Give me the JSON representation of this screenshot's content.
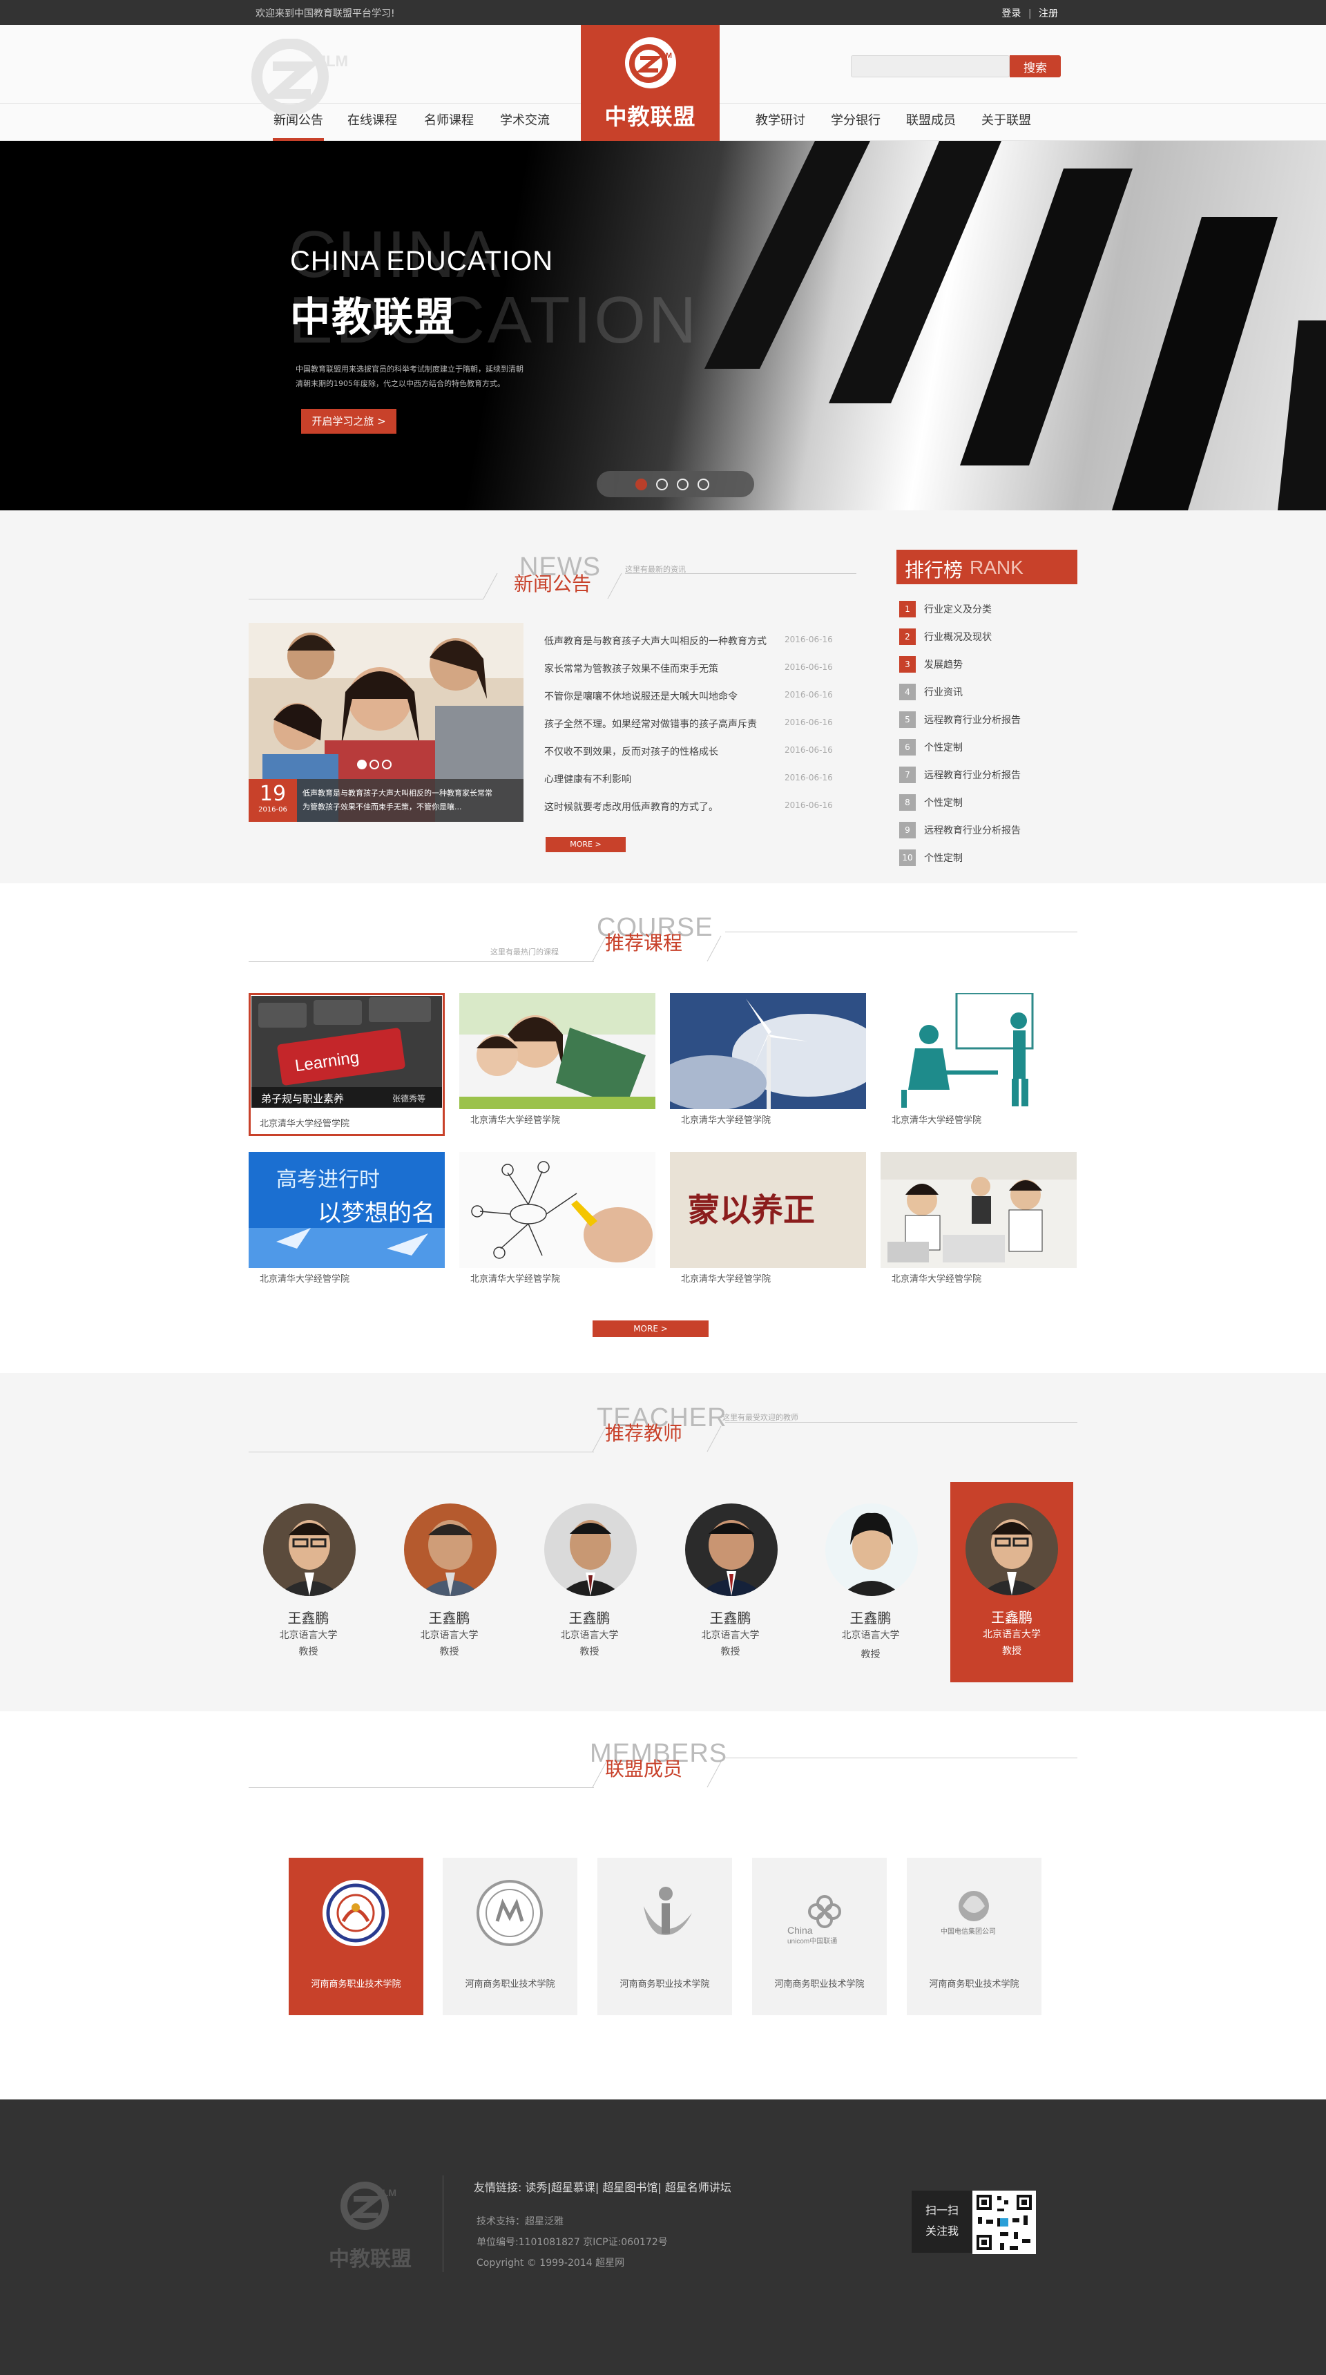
{
  "topbar": {
    "welcome": "欢迎来到中国教育联盟平台学习!",
    "login": "登录",
    "separator": "|",
    "register": "注册"
  },
  "header": {
    "brand_name": "中教联盟",
    "logo_letters": "JLM",
    "search_placeholder": "",
    "search_button": "搜索",
    "nav_left": [
      "新闻公告",
      "在线课程",
      "名师课程",
      "学术交流"
    ],
    "nav_right": [
      "教学研讨",
      "学分银行",
      "联盟成员",
      "关于联盟"
    ],
    "active_nav": "新闻公告"
  },
  "hero": {
    "ghost_line1": "CHINA",
    "ghost_line2": "EDUCATION",
    "title_en": "CHINA EDUCATION",
    "title_cn": "中教联盟",
    "desc_line1": "中国教育联盟用来选拔官员的科举考试制度建立于隋朝，延续到清朝",
    "desc_line2": "清朝末期的1905年废除，代之以中西方结合的特色教育方式。",
    "button": "开启学习之旅 >",
    "slides": 4,
    "active_slide": 1
  },
  "news": {
    "title_en": "NEWS",
    "title_cn": "新闻公告",
    "subtitle": "这里有最新的资讯",
    "feature_day": "19",
    "feature_month": "2016-06",
    "feature_caption1": "低声教育是与教育孩子大声大叫相反的一种教育家长常常",
    "feature_caption2": "为管教孩子效果不佳而束手无策，不管你是嚷...",
    "items": [
      {
        "title": "低声教育是与教育孩子大声大叫相反的一种教育方式",
        "date": "2016-06-16"
      },
      {
        "title": "家长常常为管教孩子效果不佳而束手无策",
        "date": "2016-06-16"
      },
      {
        "title": "不管你是嚷嚷不休地说服还是大喊大叫地命令",
        "date": "2016-06-16"
      },
      {
        "title": "孩子全然不理。如果经常对做错事的孩子高声斥责",
        "date": "2016-06-16"
      },
      {
        "title": "不仅收不到效果，反而对孩子的性格成长",
        "date": "2016-06-16"
      },
      {
        "title": "心理健康有不利影响",
        "date": "2016-06-16"
      },
      {
        "title": "这时候就要考虑改用低声教育的方式了。",
        "date": "2016-06-16"
      }
    ],
    "more": "MORE >"
  },
  "rank": {
    "title_cn": "排行榜",
    "title_en": "RANK",
    "items": [
      {
        "n": "1",
        "label": "行业定义及分类"
      },
      {
        "n": "2",
        "label": "行业概况及现状"
      },
      {
        "n": "3",
        "label": "发展趋势"
      },
      {
        "n": "4",
        "label": "行业资讯"
      },
      {
        "n": "5",
        "label": "远程教育行业分析报告"
      },
      {
        "n": "6",
        "label": "个性定制"
      },
      {
        "n": "7",
        "label": "远程教育行业分析报告"
      },
      {
        "n": "8",
        "label": "个性定制"
      },
      {
        "n": "9",
        "label": "远程教育行业分析报告"
      },
      {
        "n": "10",
        "label": "个性定制"
      }
    ],
    "colors": {
      "top": "#c8412a",
      "rest": "#a9a9a9"
    }
  },
  "course": {
    "title_en": "COURSE",
    "title_cn": "推荐课程",
    "subtitle": "这里有最热门的课程",
    "featured_overlay": "弟子规与职业素养",
    "featured_teacher": "张德秀等",
    "featured_img_word": "Learning",
    "gaokao_line1": "高考进行时",
    "gaokao_line2": "以梦想的名",
    "calligraphy": "蒙以养正",
    "items": [
      "北京清华大学经管学院",
      "北京清华大学经管学院",
      "北京清华大学经管学院",
      "北京清华大学经管学院",
      "北京清华大学经管学院",
      "北京清华大学经管学院",
      "北京清华大学经管学院",
      "北京清华大学经管学院"
    ],
    "more": "MORE >"
  },
  "teacher": {
    "title_en": "TEACHER",
    "title_cn": "推荐教师",
    "subtitle": "这里有最受欢迎的教师",
    "items": [
      {
        "name": "王鑫鹏",
        "school": "北京语言大学",
        "position": "教授"
      },
      {
        "name": "王鑫鹏",
        "school": "北京语言大学",
        "position": "教授"
      },
      {
        "name": "王鑫鹏",
        "school": "北京语言大学",
        "position": "教授"
      },
      {
        "name": "王鑫鹏",
        "school": "北京语言大学",
        "position": "教授"
      },
      {
        "name": "王鑫鹏",
        "school": "北京语言大学",
        "position": "教授"
      },
      {
        "name": "王鑫鹏",
        "school": "北京语言大学",
        "position": "教授"
      }
    ]
  },
  "members": {
    "title_en": "MEMBERS",
    "title_cn": "联盟成员",
    "unicom_en1": "China",
    "unicom_en2": "unicom中国联通",
    "telecom": "中国电信集团公司",
    "items": [
      "河南商务职业技术学院",
      "河南商务职业技术学院",
      "河南商务职业技术学院",
      "河南商务职业技术学院",
      "河南商务职业技术学院"
    ]
  },
  "footer": {
    "brand": "中教联盟",
    "links": "友情链接: 读秀|超星慕课| 超星图书馆| 超星名师讲坛",
    "support": "技术支持：超星泛雅",
    "unit": "单位编号:1101081827    京ICP证:060172号",
    "copyright": "Copyright © 1999-2014 超星网",
    "follow1": "扫一扫",
    "follow2": "关注我"
  },
  "colors": {
    "accent": "#c8412a",
    "dark": "#333333",
    "light_bg": "#f5f5f5"
  }
}
